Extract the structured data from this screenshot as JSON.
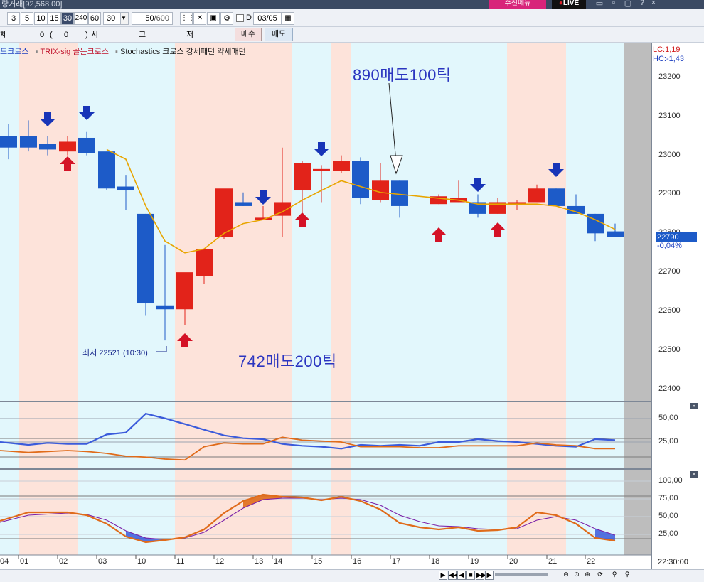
{
  "titlebar": {
    "text": "량거래[92,568.00]",
    "promo": "추천메뉴",
    "live": "LIVE",
    "icons": [
      "window-icon",
      "minimize-icon",
      "restore-icon",
      "help-icon",
      "close-icon"
    ]
  },
  "toolbar": {
    "periods": [
      "3",
      "5",
      "10",
      "15",
      "30",
      "240",
      "60"
    ],
    "active_period": "30",
    "interval_value": "30",
    "count_value": "50",
    "count_max": "/600",
    "d_label": "D",
    "date": "03/05"
  },
  "toolbar2": {
    "left_label": "체",
    "qty": "0",
    "paren_value": "0",
    "start_label": "시",
    "high_label": "고",
    "low_label": "저",
    "buy_button": "매수",
    "sell_button": "매도"
  },
  "legend": {
    "items": [
      {
        "label": "드크로스",
        "color": "#1d3fc0"
      },
      {
        "label": "TRIX-sig 골든크로스",
        "color": "#c0122b"
      },
      {
        "label": "Stochastics 크로스 강세패턴  약세패턴",
        "color": "#1a1a1a"
      }
    ]
  },
  "indicators": {
    "lc": "LC:1,19",
    "hc": "HC:-1,43"
  },
  "price_axis": [
    "23200",
    "23100",
    "23000",
    "22900",
    "22800",
    "22700",
    "22600",
    "22500",
    "22400"
  ],
  "current_price": "22790",
  "current_change": "-0,04%",
  "annotations": {
    "sell1": "890매도100틱",
    "sell2": "742매도200틱",
    "low": "최저 22521 (10:30)"
  },
  "sub1_axis": [
    "50,00",
    "25,00"
  ],
  "sub2_axis": [
    "100,00",
    "75,00",
    "50,00",
    "25,00"
  ],
  "x_axis": [
    "04",
    "01",
    "02",
    "03",
    "10",
    "11",
    "12",
    "13",
    "14",
    "15",
    "16",
    "17",
    "18",
    "19",
    "20",
    "21",
    "22"
  ],
  "time_label": "22:30:00",
  "colors": {
    "up": "#e2231a",
    "down": "#1d5bc8",
    "ma": "#e8a500",
    "band_pink": "#fde3da",
    "band_cyan": "#e2f7fc",
    "stoch_k": "#3b5bdb",
    "stoch_d": "#e06b1a"
  }
}
